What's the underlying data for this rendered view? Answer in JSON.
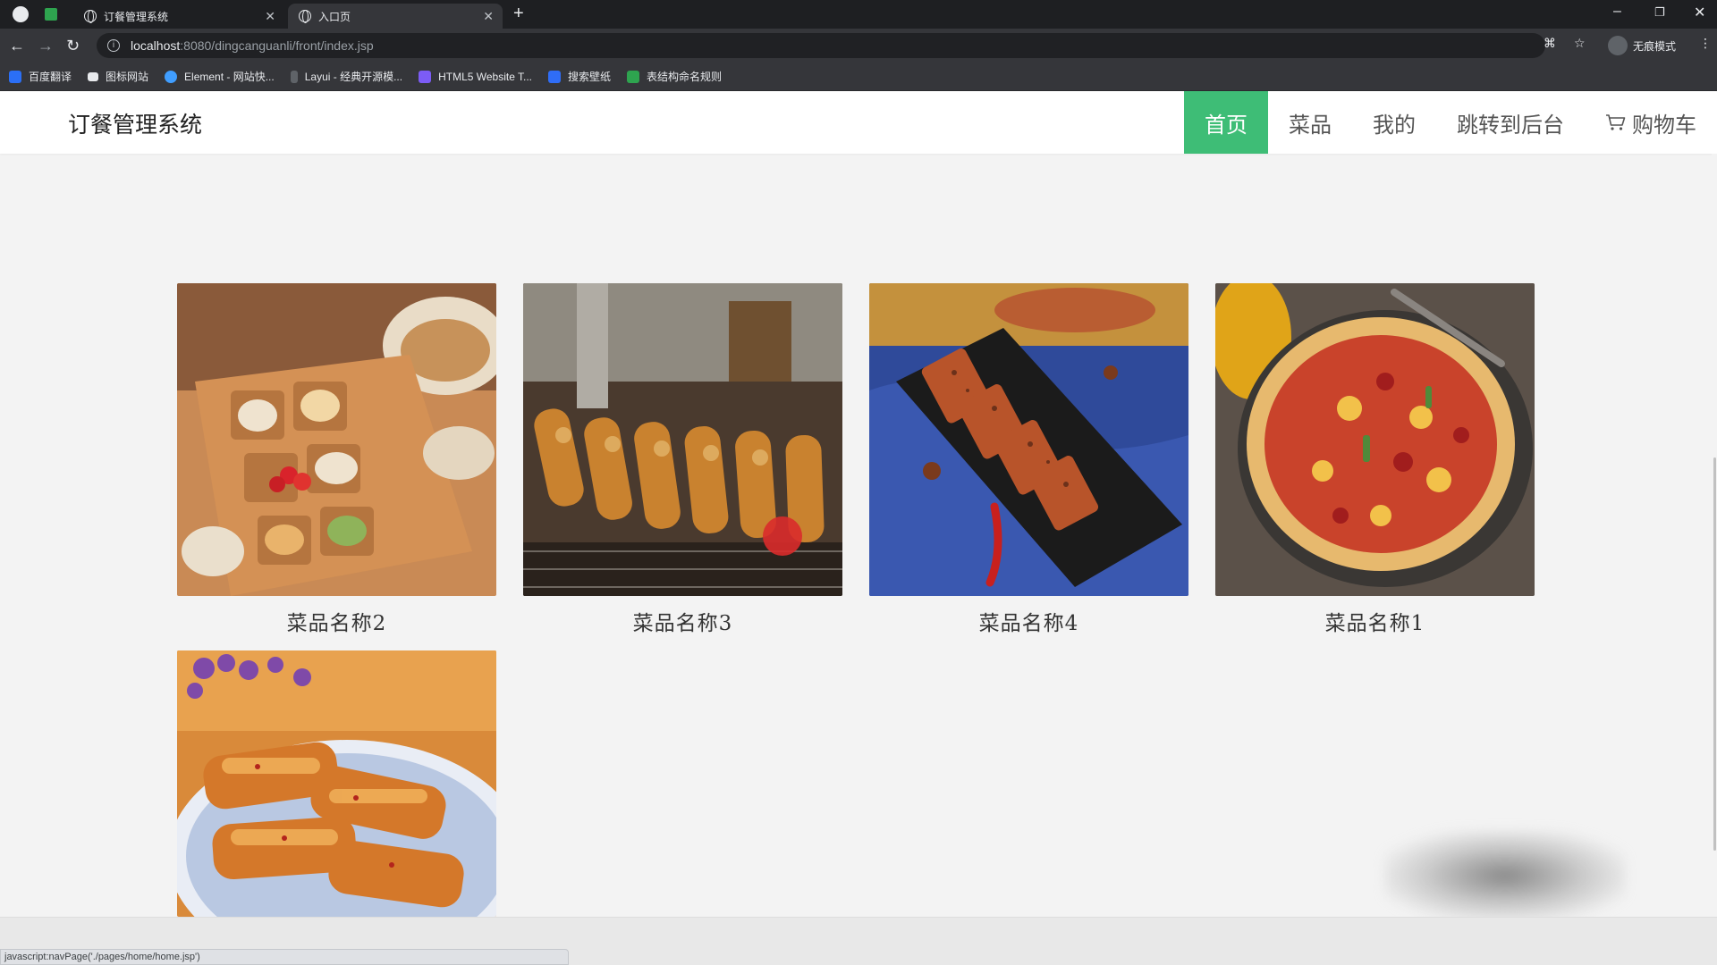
{
  "browser": {
    "tabs": [
      {
        "title": "订餐管理系统",
        "active": false
      },
      {
        "title": "入口页",
        "active": true
      }
    ],
    "url_host": "localhost",
    "url_path": ":8080/dingcanguanli/front/index.jsp",
    "profile_label": "无痕模式",
    "bookmarks": [
      "百度翻译",
      "图标网站",
      "Element - 网站快...",
      "Layui - 经典开源模...",
      "HTML5 Website T...",
      "搜索壁纸",
      "表结构命名规则"
    ]
  },
  "site": {
    "brand": "订餐管理系统",
    "nav": [
      {
        "label": "首页",
        "active": true
      },
      {
        "label": "菜品",
        "active": false
      },
      {
        "label": "我的",
        "active": false
      },
      {
        "label": "跳转到后台",
        "active": false
      },
      {
        "label": "购物车",
        "active": false,
        "icon": "cart-icon"
      }
    ],
    "dishes": [
      {
        "name": "菜品名称2",
        "image": "bento-box-image"
      },
      {
        "name": "菜品名称3",
        "image": "grilled-skewers-image"
      },
      {
        "name": "菜品名称4",
        "image": "fried-tofu-image"
      },
      {
        "name": "菜品名称1",
        "image": "pizza-image"
      },
      {
        "name": "",
        "image": "pastry-image"
      }
    ]
  },
  "status_text": "javascript:navPage('./pages/home/home.jsp')",
  "colors": {
    "accent": "#3ebd76",
    "page_bg": "#f3f3f3"
  }
}
